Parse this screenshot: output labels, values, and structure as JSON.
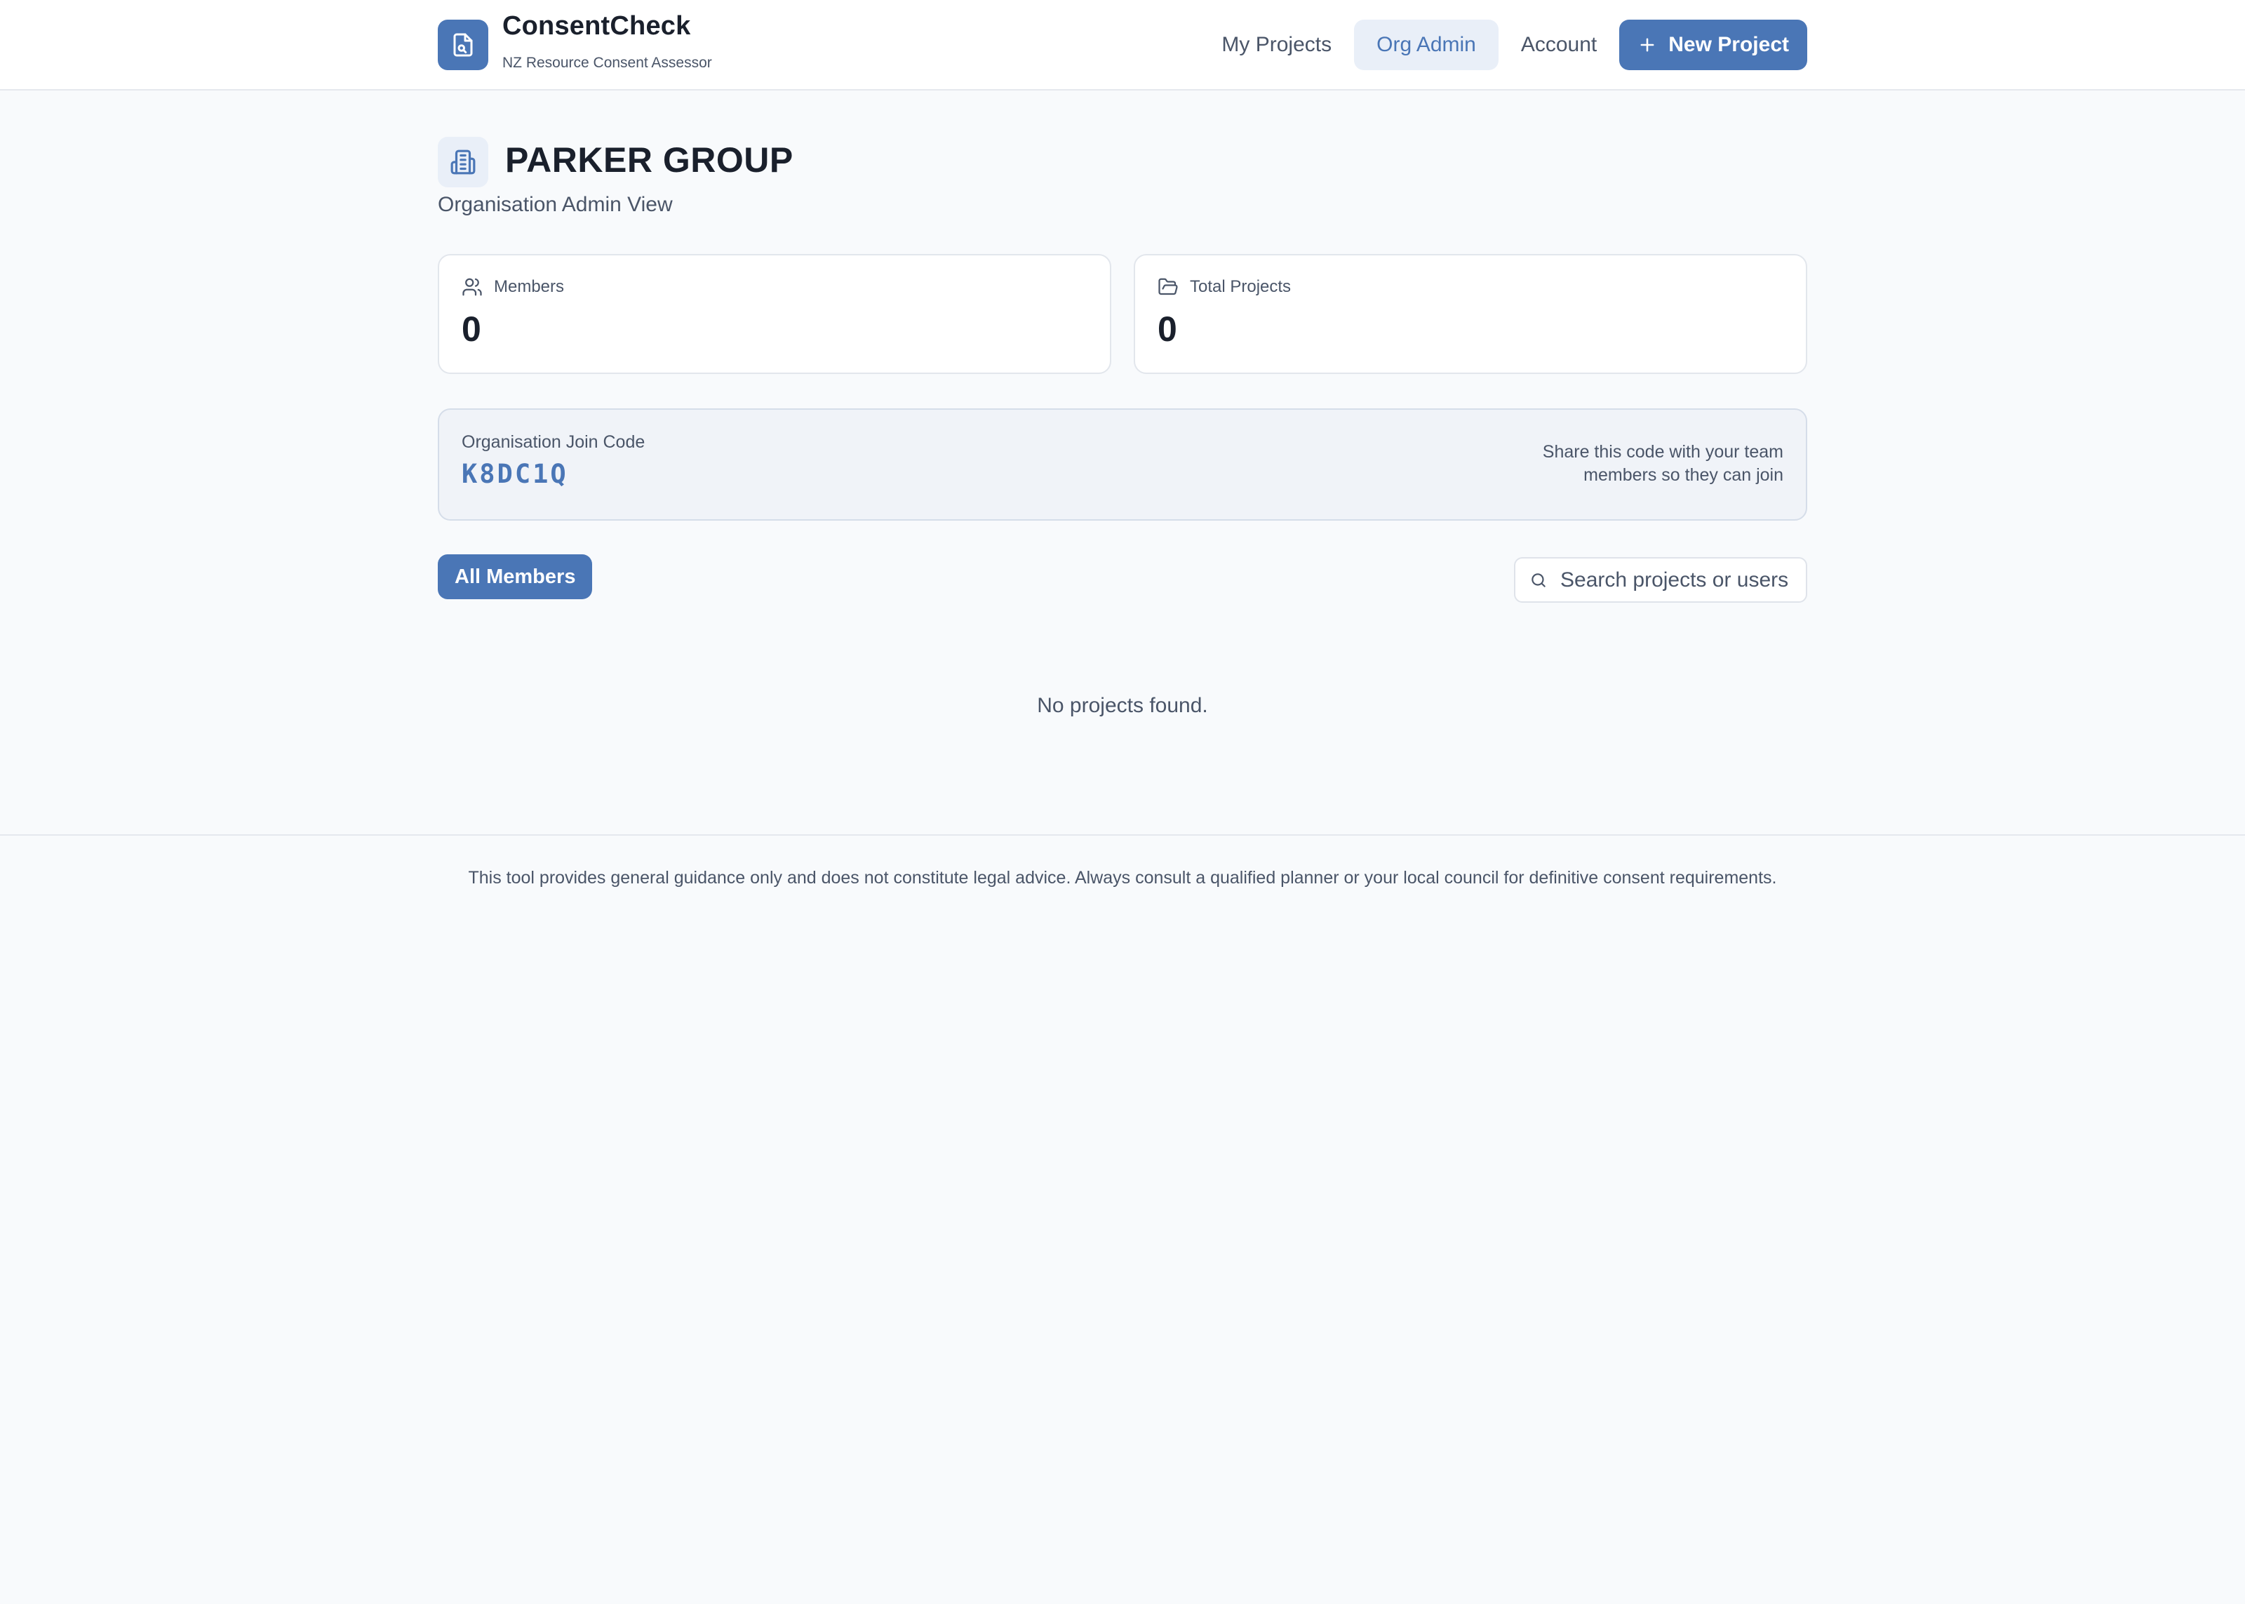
{
  "header": {
    "brand_name": "ConsentCheck",
    "brand_sub": "NZ Resource Consent Assessor",
    "nav": {
      "my_projects": "My Projects",
      "org_admin": "Org Admin",
      "account": "Account",
      "new_project": "New Project"
    }
  },
  "org": {
    "name": "PARKER GROUP",
    "subtitle": "Organisation Admin View"
  },
  "stats": {
    "members_label": "Members",
    "members_value": "0",
    "projects_label": "Total Projects",
    "projects_value": "0"
  },
  "join": {
    "label": "Organisation Join Code",
    "code": "K8DC1Q",
    "hint": "Share this code with your team members so they can join"
  },
  "filters": {
    "tab_all_members": "All Members",
    "search_placeholder": "Search projects or users"
  },
  "list": {
    "empty_text": "No projects found."
  },
  "footer": {
    "disclaimer": "This tool provides general guidance only and does not constitute legal advice. Always consult a qualified planner or your local council for definitive consent requirements."
  },
  "colors": {
    "accent": "#4a76b6",
    "accent_soft": "#e9eff8",
    "background": "#f8fafc"
  },
  "icons": {
    "logo": "document-search-icon",
    "org": "building-icon",
    "members": "users-icon",
    "projects": "folder-open-icon",
    "search": "search-icon",
    "new_project": "plus-icon"
  }
}
